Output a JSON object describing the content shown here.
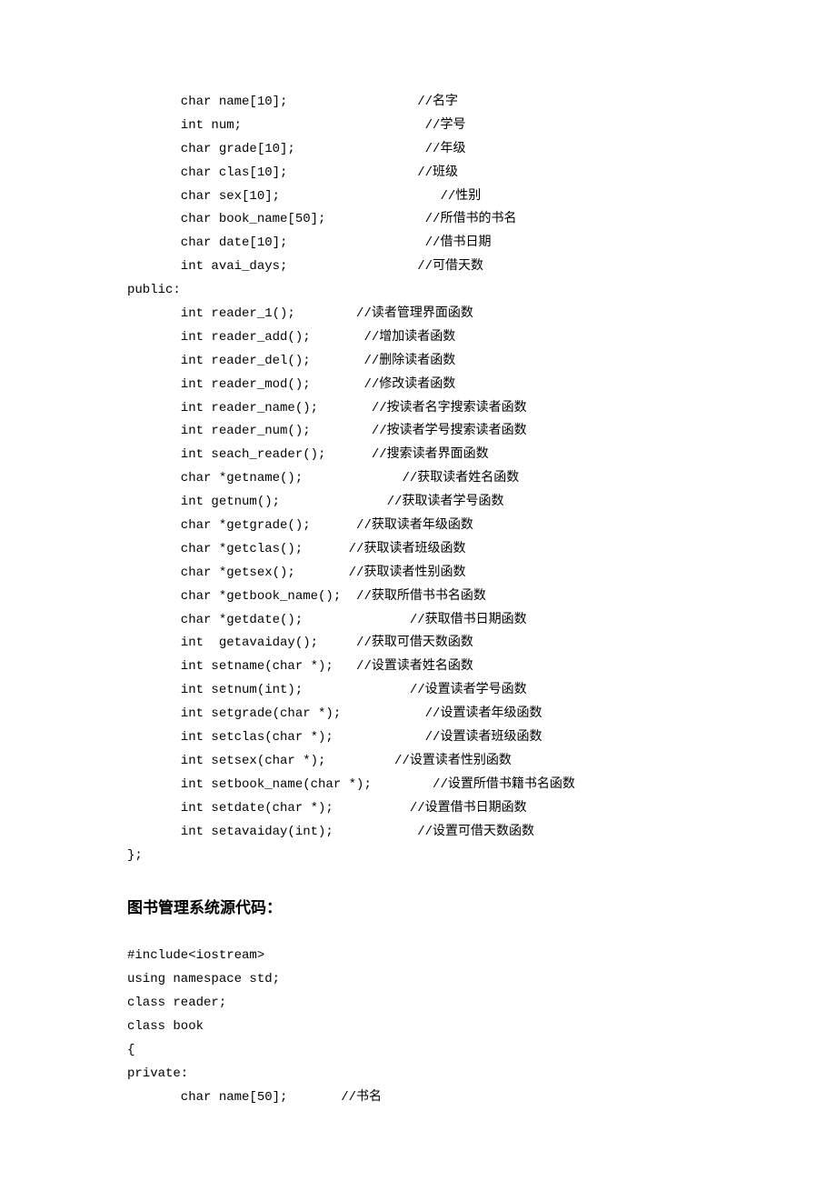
{
  "lines": [
    "       char name[10];                 //名字",
    "       int num;                        //学号",
    "       char grade[10];                 //年级",
    "       char clas[10];                 //班级",
    "       char sex[10];                     //性别",
    "       char book_name[50];             //所借书的书名",
    "       char date[10];                  //借书日期",
    "       int avai_days;                 //可借天数",
    "public:",
    "       int reader_1();        //读者管理界面函数",
    "       int reader_add();       //增加读者函数",
    "       int reader_del();       //删除读者函数",
    "       int reader_mod();       //修改读者函数",
    "       int reader_name();       //按读者名字搜索读者函数",
    "       int reader_num();        //按读者学号搜索读者函数",
    "       int seach_reader();      //搜索读者界面函数",
    "       char *getname();             //获取读者姓名函数",
    "       int getnum();              //获取读者学号函数",
    "       char *getgrade();      //获取读者年级函数",
    "       char *getclas();      //获取读者班级函数",
    "       char *getsex();       //获取读者性别函数",
    "       char *getbook_name();  //获取所借书书名函数",
    "       char *getdate();              //获取借书日期函数",
    "       int  getavaiday();     //获取可借天数函数",
    "       int setname(char *);   //设置读者姓名函数",
    "       int setnum(int);              //设置读者学号函数",
    "       int setgrade(char *);           //设置读者年级函数",
    "       int setclas(char *);            //设置读者班级函数",
    "       int setsex(char *);         //设置读者性别函数",
    "       int setbook_name(char *);        //设置所借书籍书名函数",
    "       int setdate(char *);          //设置借书日期函数",
    "       int setavaiday(int);           //设置可借天数函数",
    "};"
  ],
  "heading": "图书管理系统源代码：",
  "lines2": [
    "#include<iostream>",
    "using namespace std;",
    "class reader;",
    "class book",
    "{",
    "private:",
    "       char name[50];       //书名"
  ]
}
